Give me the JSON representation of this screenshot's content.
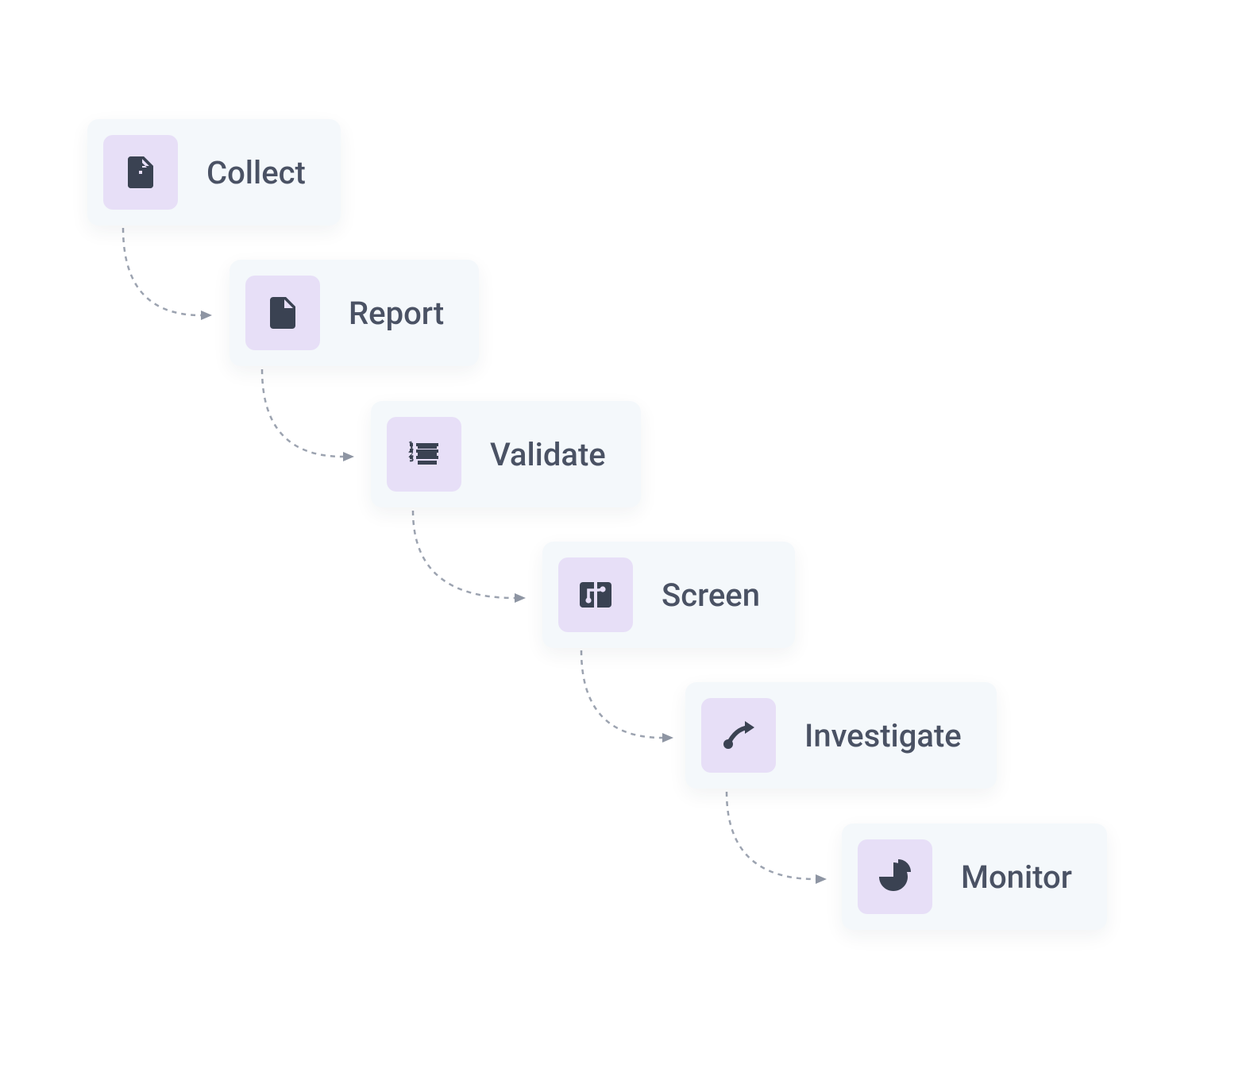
{
  "diagram": {
    "steps": [
      {
        "label": "Collect",
        "icon": "file-upload-icon"
      },
      {
        "label": "Report",
        "icon": "file-icon"
      },
      {
        "label": "Validate",
        "icon": "list-ordered-icon"
      },
      {
        "label": "Screen",
        "icon": "circuit-icon"
      },
      {
        "label": "Investigate",
        "icon": "arrow-path-icon"
      },
      {
        "label": "Monitor",
        "icon": "pie-chart-icon"
      }
    ],
    "colors": {
      "card_bg": "#f4f8fb",
      "icon_bg": "#e7dff7",
      "icon_fg": "#3a4252",
      "text": "#4a5264",
      "connector": "#9ca3b0"
    }
  }
}
